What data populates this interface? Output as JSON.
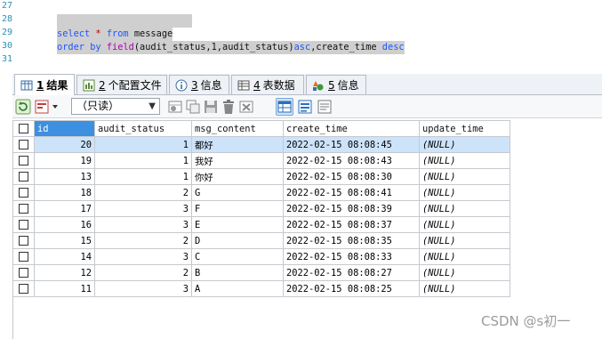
{
  "editor": {
    "line_numbers": [
      "27",
      "28",
      "29",
      "30",
      "31"
    ],
    "line29": {
      "kw1": "select",
      "star": "*",
      "kw2": "from",
      "table": "message"
    },
    "line30": {
      "kw1": "order by",
      "fn": "field",
      "args": "(audit_status,1,audit_status)",
      "asc": "asc",
      "sep": ",create_time ",
      "desc": "desc"
    }
  },
  "tabs": [
    {
      "num": "1",
      "label": "结果"
    },
    {
      "num": "2",
      "label": "个配置文件"
    },
    {
      "num": "3",
      "label": "信息"
    },
    {
      "num": "4",
      "label": "表数据"
    },
    {
      "num": "5",
      "label": "信息"
    }
  ],
  "toolbar": {
    "readonly_select": "（只读）",
    "dropdown_arrow": "▼"
  },
  "grid": {
    "columns": [
      "id",
      "audit_status",
      "msg_content",
      "create_time",
      "update_time"
    ],
    "rows": [
      {
        "id": "20",
        "audit_status": "1",
        "msg_content": "都好",
        "create_time": "2022-02-15 08:08:45",
        "update_time": "(NULL)"
      },
      {
        "id": "19",
        "audit_status": "1",
        "msg_content": "我好",
        "create_time": "2022-02-15 08:08:43",
        "update_time": "(NULL)"
      },
      {
        "id": "13",
        "audit_status": "1",
        "msg_content": "你好",
        "create_time": "2022-02-15 08:08:30",
        "update_time": "(NULL)"
      },
      {
        "id": "18",
        "audit_status": "2",
        "msg_content": "G",
        "create_time": "2022-02-15 08:08:41",
        "update_time": "(NULL)"
      },
      {
        "id": "17",
        "audit_status": "3",
        "msg_content": "F",
        "create_time": "2022-02-15 08:08:39",
        "update_time": "(NULL)"
      },
      {
        "id": "16",
        "audit_status": "3",
        "msg_content": "E",
        "create_time": "2022-02-15 08:08:37",
        "update_time": "(NULL)"
      },
      {
        "id": "15",
        "audit_status": "2",
        "msg_content": "D",
        "create_time": "2022-02-15 08:08:35",
        "update_time": "(NULL)"
      },
      {
        "id": "14",
        "audit_status": "3",
        "msg_content": "C",
        "create_time": "2022-02-15 08:08:33",
        "update_time": "(NULL)"
      },
      {
        "id": "12",
        "audit_status": "2",
        "msg_content": "B",
        "create_time": "2022-02-15 08:08:27",
        "update_time": "(NULL)"
      },
      {
        "id": "11",
        "audit_status": "3",
        "msg_content": "A",
        "create_time": "2022-02-15 08:08:25",
        "update_time": "(NULL)"
      }
    ]
  },
  "watermark": "CSDN @s初一"
}
